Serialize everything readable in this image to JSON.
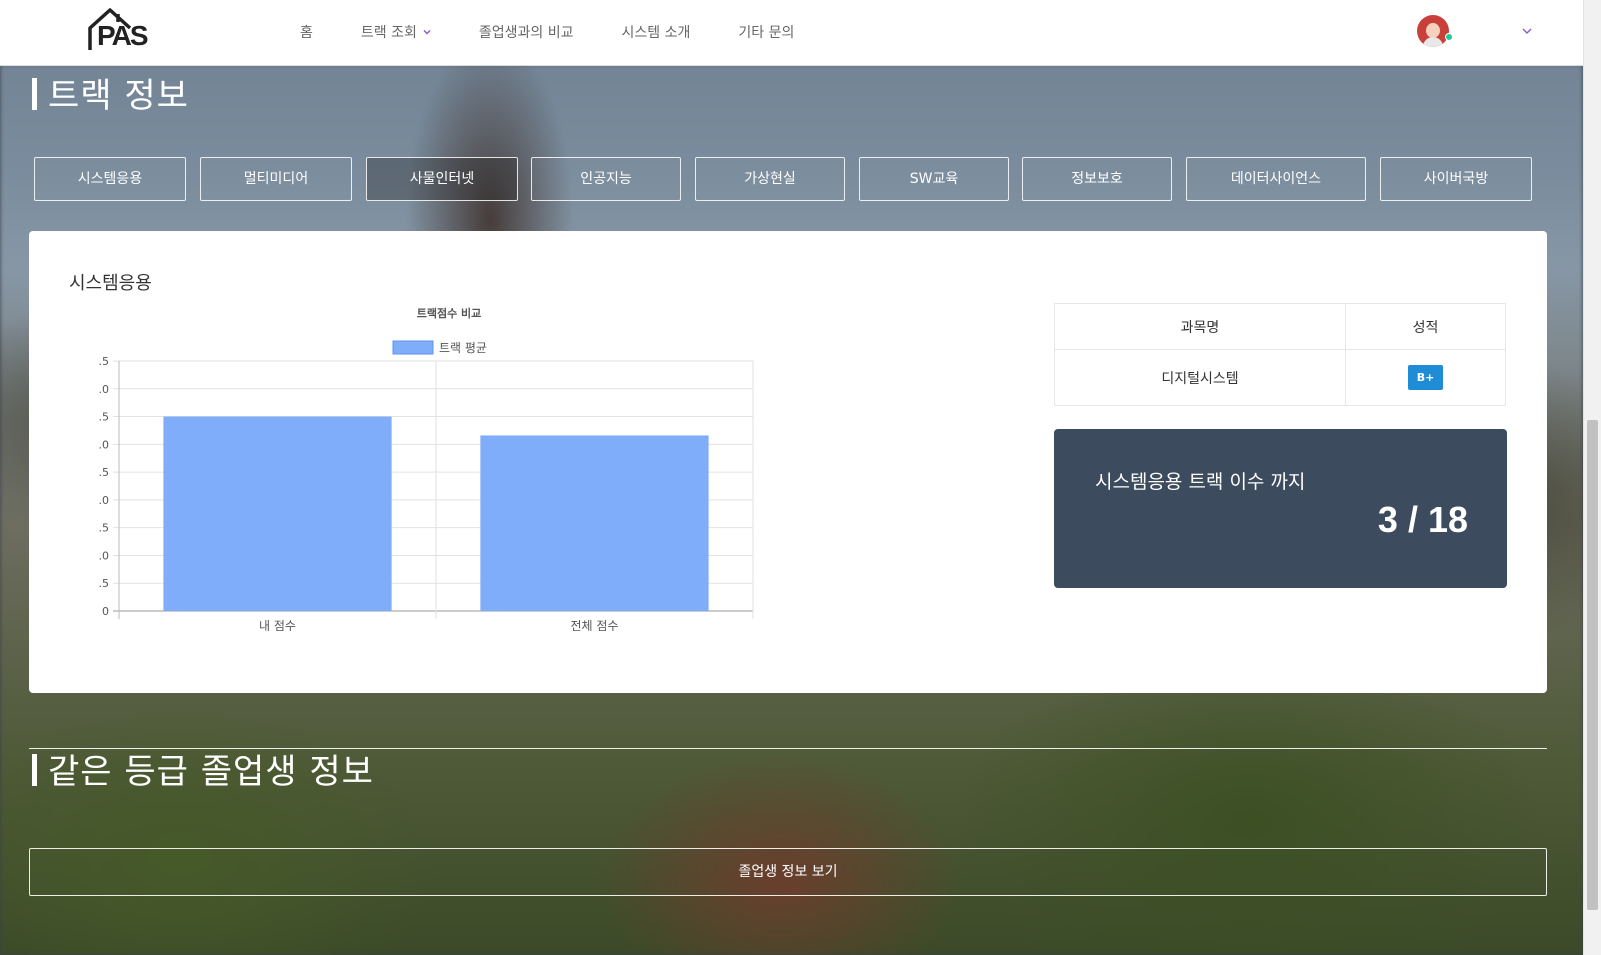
{
  "nav": {
    "logo_text": "PAS",
    "items": [
      "홈",
      "트랙 조회",
      "졸업생과의 비교",
      "시스템 소개",
      "기타 문의"
    ]
  },
  "track_section": {
    "title": "트랙 정보",
    "tracks": [
      "시스템응용",
      "멀티미디어",
      "사물인터넷",
      "인공지능",
      "가상현실",
      "SW교육",
      "정보보호",
      "데이터사이언스",
      "사이버국방"
    ],
    "selected_track": "사물인터넷"
  },
  "card": {
    "title": "시스템응용",
    "table": {
      "headers": [
        "과목명",
        "성적"
      ],
      "rows": [
        {
          "subject": "디지털시스템",
          "grade": "B+"
        }
      ]
    },
    "progress": {
      "label": "시스템응용 트랙 이수 까지",
      "value": "3 / 18"
    }
  },
  "chart_data": {
    "type": "bar",
    "title": "트랙점수 비교",
    "legend": [
      "트랙 평균"
    ],
    "categories": [
      "내 점수",
      "전체 점수"
    ],
    "series": [
      {
        "name": "트랙 평균",
        "values": [
          3.5,
          3.16
        ]
      }
    ],
    "y_tick_labels": [
      ".5",
      ".0",
      ".5",
      ".0",
      ".5",
      ".0",
      ".5",
      ".0",
      ".5",
      "0"
    ],
    "ylim": [
      0,
      4.5
    ],
    "grid": true,
    "bar_color": "#7fadf9"
  },
  "graduates_section": {
    "title": "같은 등급 졸업생 정보",
    "button_label": "졸업생 정보 보기"
  }
}
